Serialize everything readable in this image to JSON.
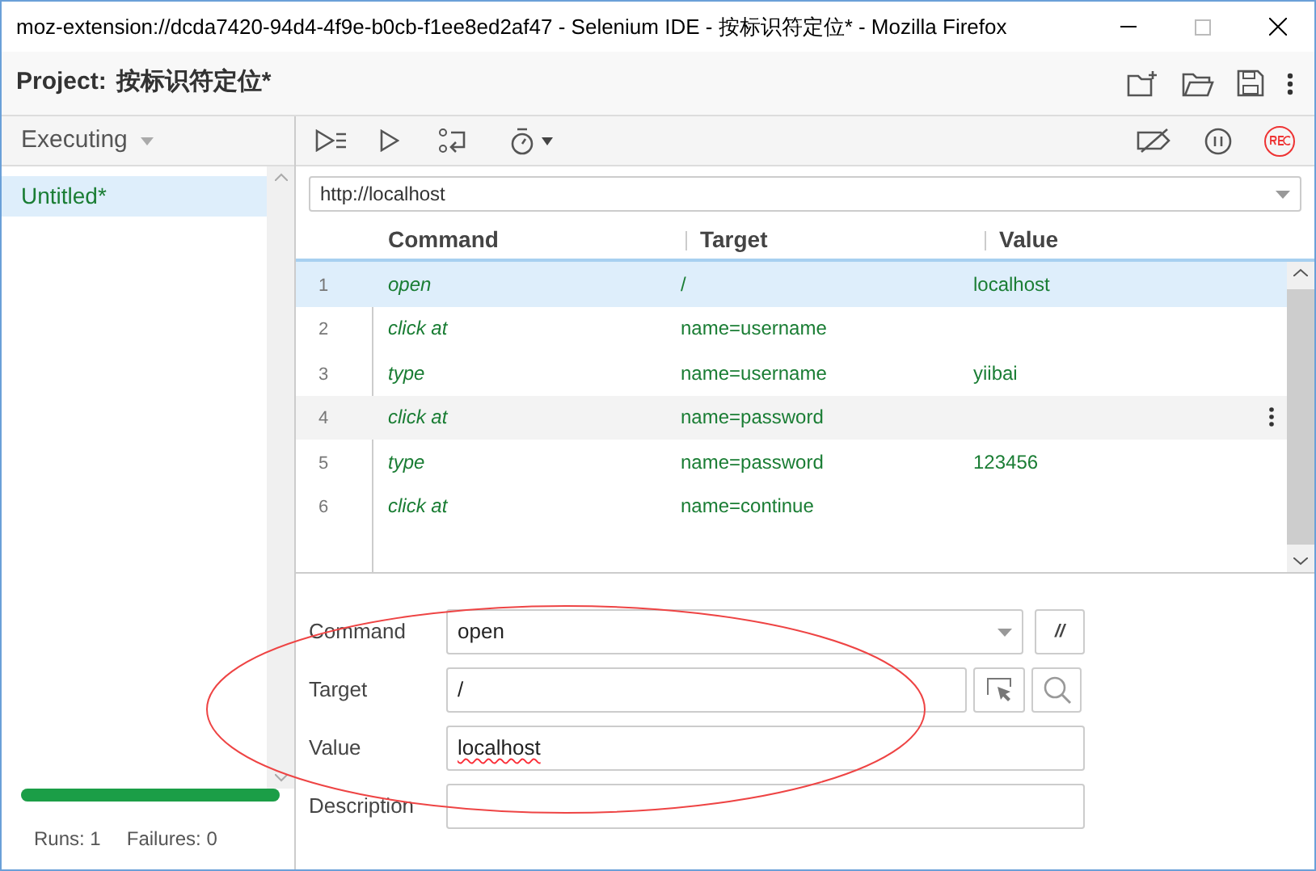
{
  "window": {
    "title": "moz-extension://dcda7420-94d4-4f9e-b0cb-f1ee8ed2af47 - Selenium IDE - 按标识符定位* - Mozilla Firefox"
  },
  "project": {
    "label": "Project:",
    "name": "按标识符定位*"
  },
  "sidebar": {
    "mode": "Executing",
    "items": [
      {
        "label": "Untitled*",
        "selected": true
      }
    ],
    "progress": {
      "level": 1
    },
    "runs": "Runs: 1",
    "failures": "Failures: 0"
  },
  "url": "http://localhost",
  "table": {
    "columns": [
      "Command",
      "Target",
      "Value"
    ],
    "rows": [
      {
        "index": "1",
        "command": "open",
        "target": "/",
        "value": "localhost",
        "selected": true,
        "hovered": false
      },
      {
        "index": "2",
        "command": "click at",
        "target": "name=username",
        "value": "",
        "selected": false,
        "hovered": false
      },
      {
        "index": "3",
        "command": "type",
        "target": "name=username",
        "value": "yiibai",
        "selected": false,
        "hovered": false
      },
      {
        "index": "4",
        "command": "click at",
        "target": "name=password",
        "value": "",
        "selected": false,
        "hovered": true
      },
      {
        "index": "5",
        "command": "type",
        "target": "name=password",
        "value": "123456",
        "selected": false,
        "hovered": false
      },
      {
        "index": "6",
        "command": "click at",
        "target": "name=continue",
        "value": "",
        "selected": false,
        "hovered": false
      }
    ]
  },
  "editor": {
    "command": {
      "label": "Command",
      "value": "open",
      "comment_button": "//"
    },
    "target": {
      "label": "Target",
      "value": "/"
    },
    "value": {
      "label": "Value",
      "value": "localhost"
    },
    "description": {
      "label": "Description"
    }
  }
}
